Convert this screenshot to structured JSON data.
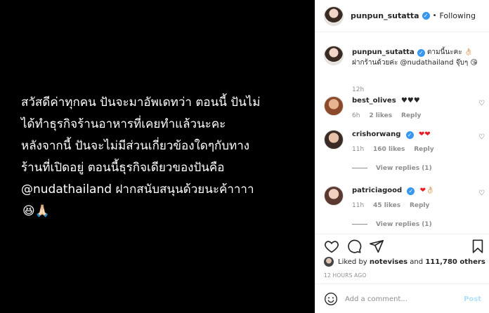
{
  "media": {
    "text": "สวัสดีค่าทุกคน ปันจะมาอัพเดทว่า ตอนนี้ ปันไม่\nได้ทำธุรกิจร้านอาหารที่เคยทำแล้วนะคะ\n หลังจากนี้ ปันจะไม่มีส่วนเกี่ยวข้องใดๆกับทาง\nร้านที่เปิดอยู่ ตอนนี้ธุรกิจเดียวของปันคือ\n@nudathailand ฝากสนับสนุนด้วยนะค้าาาา",
    "emoji": "😆🙏🏻"
  },
  "header": {
    "username": "punpun_sutatta",
    "separator": "•",
    "follow_label": "Following"
  },
  "caption": {
    "username": "punpun_sutatta",
    "text": "ตามนี้นะคะ 👌🏻 ฝากร้านด้วยค่ะ @nudathailand จุ๊บๆ 😘",
    "time": "12h"
  },
  "comments": [
    {
      "username": "best_olives",
      "text": "♥♥♥",
      "time": "6h",
      "likes": "2 likes",
      "reply": "Reply"
    },
    {
      "username": "crishorwang",
      "text": "❤❤",
      "time": "11h",
      "likes": "160 likes",
      "reply": "Reply",
      "view_replies": "View replies (1)"
    },
    {
      "username": "patriciagood",
      "text": "❤👌🏻",
      "time": "11h",
      "likes": "45 likes",
      "reply": "Reply",
      "view_replies": "View replies (1)"
    }
  ],
  "actions": {
    "liked_prefix": "Liked by",
    "liked_user": "notevises",
    "liked_and": "and",
    "liked_count": "111,780 others",
    "post_time": "12 HOURS AGO"
  },
  "add_comment": {
    "placeholder": "Add a comment...",
    "post_label": "Post"
  },
  "icons": [
    "heart-icon",
    "comment-icon",
    "share-icon",
    "bookmark-icon",
    "emoji-icon",
    "verified-icon"
  ],
  "colors": {
    "verified": "#3897f0",
    "heart_red": "#ed1c24",
    "post_disabled": "#b2dffc",
    "muted": "#8e8e8e"
  }
}
